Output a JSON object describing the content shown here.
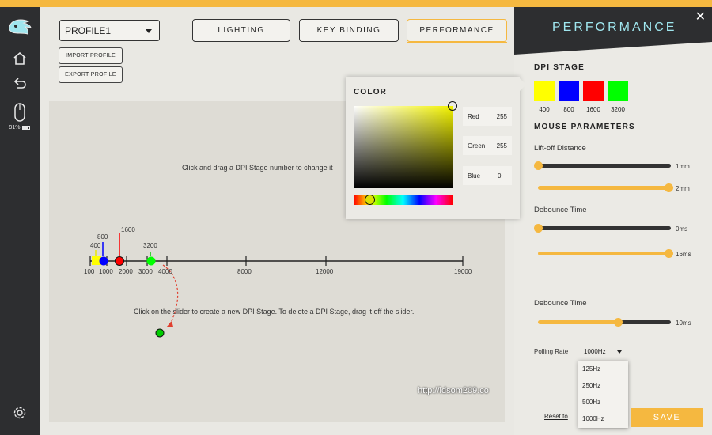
{
  "profile": {
    "selected": "PROFILE1",
    "import_label": "IMPORT PROFILE",
    "export_label": "EXPORT PROFILE"
  },
  "tabs": [
    {
      "label": "LIGHTING"
    },
    {
      "label": "KEY BINDING"
    },
    {
      "label": "PERFORMANCE"
    }
  ],
  "sidebar": {
    "battery": "91%"
  },
  "canvas": {
    "hint_drag": "Click and drag a DPI Stage number to change it",
    "hint_slider": "Click on the slider to create a new DPI Stage. To delete a DPI Stage, drag it off the slider.",
    "axis_labels": [
      "100",
      "1000",
      "2000",
      "3000",
      "4000",
      "8000",
      "12000",
      "19000"
    ],
    "stage_labels": [
      "400",
      "800",
      "1600",
      "3200"
    ]
  },
  "color_picker": {
    "title": "COLOR",
    "red_label": "Red",
    "red_value": "255",
    "green_label": "Green",
    "green_value": "255",
    "blue_label": "Blue",
    "blue_value": "0"
  },
  "panel": {
    "title": "PERFORMANCE",
    "dpi_title": "DPI STAGE",
    "dpi_stages": [
      {
        "value": "400",
        "color": "#ffff00"
      },
      {
        "value": "800",
        "color": "#0000ff"
      },
      {
        "value": "1600",
        "color": "#ff0000"
      },
      {
        "value": "3200",
        "color": "#00ff00"
      }
    ],
    "mouse_title": "MOUSE PARAMETERS",
    "liftoff_label": "Lift-off Distance",
    "liftoff_val1": "1mm",
    "liftoff_val2": "2mm",
    "debounce_label": "Debounce Time",
    "debounce_val1": "0ms",
    "debounce_val2": "16ms",
    "debounce2_label": "Debounce Time",
    "debounce2_val": "10ms",
    "polling_label": "Polling Rate",
    "polling_value": "1000Hz",
    "polling_options": [
      "125Hz",
      "250Hz",
      "500Hz",
      "1000Hz"
    ],
    "reset_label": "Reset to",
    "save_label": "SAVE"
  },
  "watermark": "http://idsom209.co"
}
